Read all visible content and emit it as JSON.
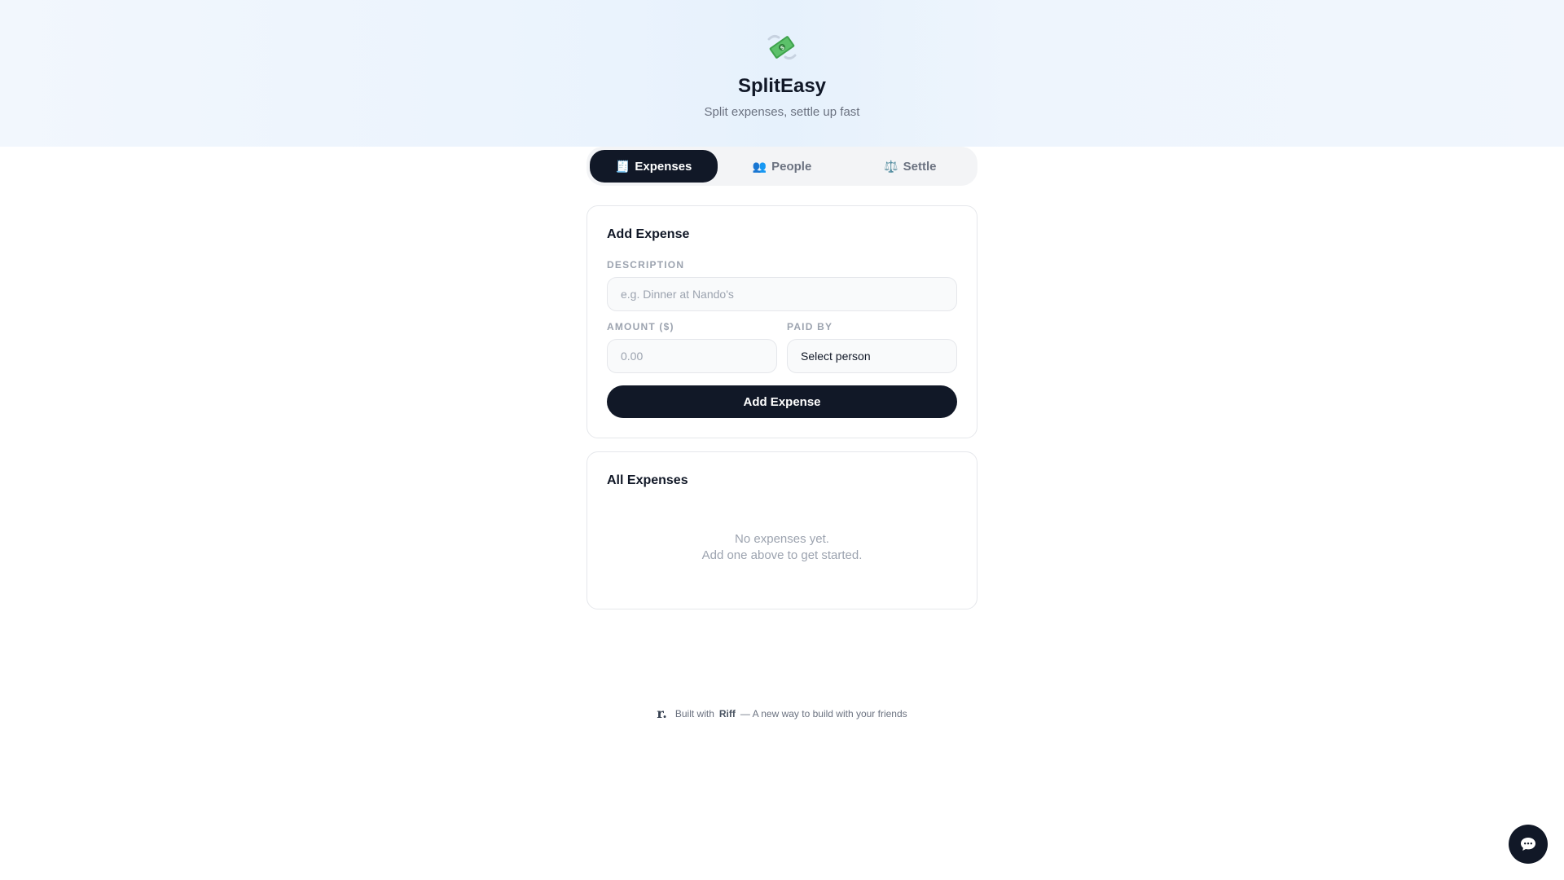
{
  "header": {
    "icon": "money-with-wings-icon",
    "title": "SplitEasy",
    "subtitle": "Split expenses, settle up fast"
  },
  "tabs": [
    {
      "glyph": "🧾",
      "label": "Expenses",
      "active": true
    },
    {
      "glyph": "👥",
      "label": "People",
      "active": false
    },
    {
      "glyph": "⚖️",
      "label": "Settle",
      "active": false
    }
  ],
  "add_expense": {
    "title": "Add Expense",
    "description_label": "DESCRIPTION",
    "description_placeholder": "e.g. Dinner at Nando's",
    "description_value": "",
    "amount_label": "AMOUNT ($)",
    "amount_placeholder": "0.00",
    "amount_value": "",
    "paid_by_label": "PAID BY",
    "paid_by_selected": "Select person",
    "submit_label": "Add Expense"
  },
  "all_expenses": {
    "title": "All Expenses",
    "empty_line1": "No expenses yet.",
    "empty_line2": "Add one above to get started."
  },
  "footer": {
    "logo": "r.",
    "built_with": "Built with",
    "brand": "Riff",
    "tagline": "— A new way to build with your friends"
  },
  "chat_button": {
    "icon": "chat-bubble-icon"
  },
  "colors": {
    "primary": "#111827",
    "muted": "#6b7280",
    "label": "#9ca3af",
    "border": "#e5e7eb",
    "hero_bg": "#eaf3fd"
  }
}
